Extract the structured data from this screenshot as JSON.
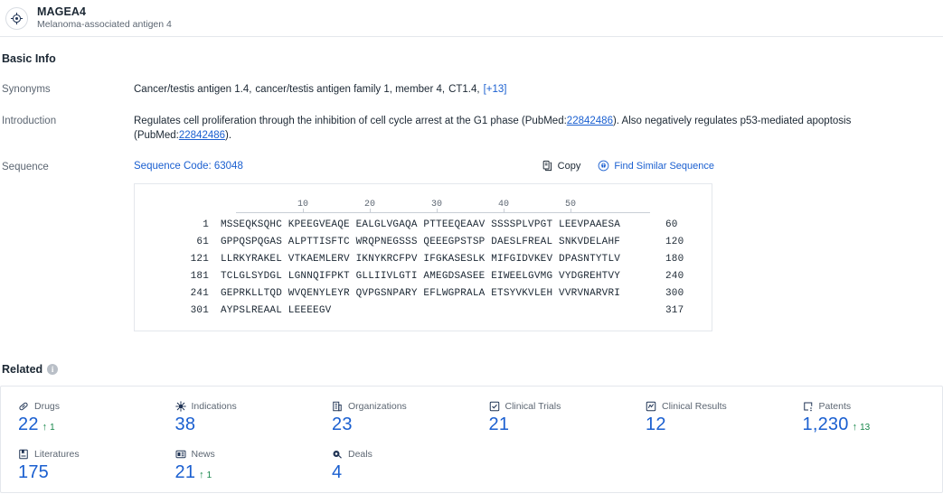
{
  "header": {
    "icon": "target-crosshair-icon",
    "title": "MAGEA4",
    "subtitle": "Melanoma-associated antigen 4"
  },
  "basic_info": {
    "section_title": "Basic Info",
    "synonyms": {
      "label": "Synonyms",
      "items": [
        "Cancer/testis antigen 1.4,",
        "cancer/testis antigen family 1, member 4,",
        "CT1.4,"
      ],
      "more_label": "[+13]"
    },
    "introduction": {
      "label": "Introduction",
      "part1": "Regulates cell proliferation through the inhibition of cell cycle arrest at the G1 phase (PubMed:",
      "pubmed1": "22842486",
      "part2": "). Also negatively regulates p53-mediated apoptosis (PubMed:",
      "pubmed2": "22842486",
      "part3": ")."
    },
    "sequence": {
      "label": "Sequence",
      "code_label": "Sequence Code: 63048",
      "copy_label": "Copy",
      "copy_icon": "copy-icon",
      "find_similar_label": "Find Similar Sequence",
      "find_similar_icon": "find-similar-sequence-icon",
      "ruler_ticks": [
        "10",
        "20",
        "30",
        "40",
        "50"
      ],
      "lines": [
        {
          "start": "1",
          "chunks": "MSSEQKSQHC KPEEGVEAQE EALGLVGAQA PTTEEQEAAV SSSSPLVPGT LEEVPAAESA",
          "end": "60"
        },
        {
          "start": "61",
          "chunks": "GPPQSPQGAS ALPTTISFTC WRQPNEGSSS QEEEGPSTSP DAESLFREAL SNKVDELAHF",
          "end": "120"
        },
        {
          "start": "121",
          "chunks": "LLRKYRAKEL VTKAEMLERV IKNYKRCFPV IFGKASESLK MIFGIDVKEV DPASNTYTLV",
          "end": "180"
        },
        {
          "start": "181",
          "chunks": "TCLGLSYDGL LGNNQIFPKT GLLIIVLGTI AMEGDSASEE EIWEELGVMG VYDGREHTVY",
          "end": "240"
        },
        {
          "start": "241",
          "chunks": "GEPRKLLTQD WVQENYLEYR QVPGSNPARY EFLWGPRALA ETSYVKVLEH VVRVNARVRI",
          "end": "300"
        },
        {
          "start": "301",
          "chunks": "AYPSLREAAL LEEEEGV",
          "end": "317"
        }
      ]
    }
  },
  "related": {
    "title": "Related",
    "info_icon": "info-icon",
    "info_glyph": "i",
    "stats": [
      {
        "icon": "pill-icon",
        "label": "Drugs",
        "value": "22",
        "delta": "1",
        "has_delta": true
      },
      {
        "icon": "virus-icon",
        "label": "Indications",
        "value": "38",
        "delta": "",
        "has_delta": false
      },
      {
        "icon": "building-icon",
        "label": "Organizations",
        "value": "23",
        "delta": "",
        "has_delta": false
      },
      {
        "icon": "clinical-trials-icon",
        "label": "Clinical Trials",
        "value": "21",
        "delta": "",
        "has_delta": false
      },
      {
        "icon": "clinical-results-icon",
        "label": "Clinical Results",
        "value": "12",
        "delta": "",
        "has_delta": false
      },
      {
        "icon": "patent-icon",
        "label": "Patents",
        "value": "1,230",
        "delta": "13",
        "has_delta": true
      },
      {
        "icon": "literature-icon",
        "label": "Literatures",
        "value": "175",
        "delta": "",
        "has_delta": false
      },
      {
        "icon": "news-icon",
        "label": "News",
        "value": "21",
        "delta": "1",
        "has_delta": true
      },
      {
        "icon": "deals-icon",
        "label": "Deals",
        "value": "4",
        "delta": "",
        "has_delta": false
      }
    ],
    "delta_arrow_glyph": "↑",
    "accent_color": "#1a5fd0",
    "delta_color": "#17864a"
  }
}
